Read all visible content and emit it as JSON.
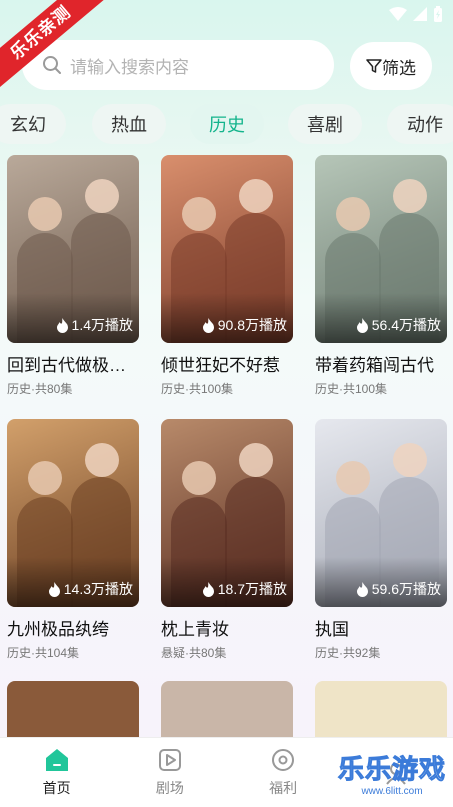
{
  "ribbon": {
    "text": "乐乐亲测"
  },
  "search": {
    "placeholder": "请输入搜索内容",
    "filter_label": "筛选"
  },
  "categories": [
    "玄幻",
    "热血",
    "历史",
    "喜剧",
    "动作"
  ],
  "active_category": "历史",
  "dramas": [
    {
      "title": "回到古代做极品家丁",
      "display_title": "回到古代做极…",
      "meta": "历史·共80集",
      "plays": "1.4万播放",
      "poster_color": "#b9a99a",
      "poster_color2": "#6e5a4c"
    },
    {
      "title": "倾世狂妃不好惹",
      "display_title": "倾世狂妃不好惹",
      "meta": "历史·共100集",
      "plays": "90.8万播放",
      "poster_color": "#d98f6d",
      "poster_color2": "#7a3c2a"
    },
    {
      "title": "带着药箱闯古代",
      "display_title": "带着药箱闯古代",
      "meta": "历史·共100集",
      "plays": "56.4万播放",
      "poster_color": "#b6c6b8",
      "poster_color2": "#6c7a70"
    },
    {
      "title": "九州极品纨绔",
      "display_title": "九州极品纨绔",
      "meta": "历史·共104集",
      "plays": "14.3万播放",
      "poster_color": "#d2a06b",
      "poster_color2": "#6b3f23"
    },
    {
      "title": "枕上青妆",
      "display_title": "枕上青妆",
      "meta": "悬疑·共80集",
      "plays": "18.7万播放",
      "poster_color": "#b88a6a",
      "poster_color2": "#5a2e22"
    },
    {
      "title": "执国",
      "display_title": "执国",
      "meta": "历史·共92集",
      "plays": "59.6万播放",
      "poster_color": "#e6e8ee",
      "poster_color2": "#a4a8b4"
    }
  ],
  "partial_posters": [
    {
      "poster_color": "#8a5a3a"
    },
    {
      "poster_color": "#c9b6a8"
    },
    {
      "poster_color": "#efe4c7"
    }
  ],
  "tabs": [
    {
      "label": "首页",
      "icon": "home-icon"
    },
    {
      "label": "剧场",
      "icon": "theater-icon"
    },
    {
      "label": "福利",
      "icon": "welfare-icon"
    }
  ],
  "watermark": {
    "title": "乐乐游戏",
    "url": "www.6litt.com"
  }
}
